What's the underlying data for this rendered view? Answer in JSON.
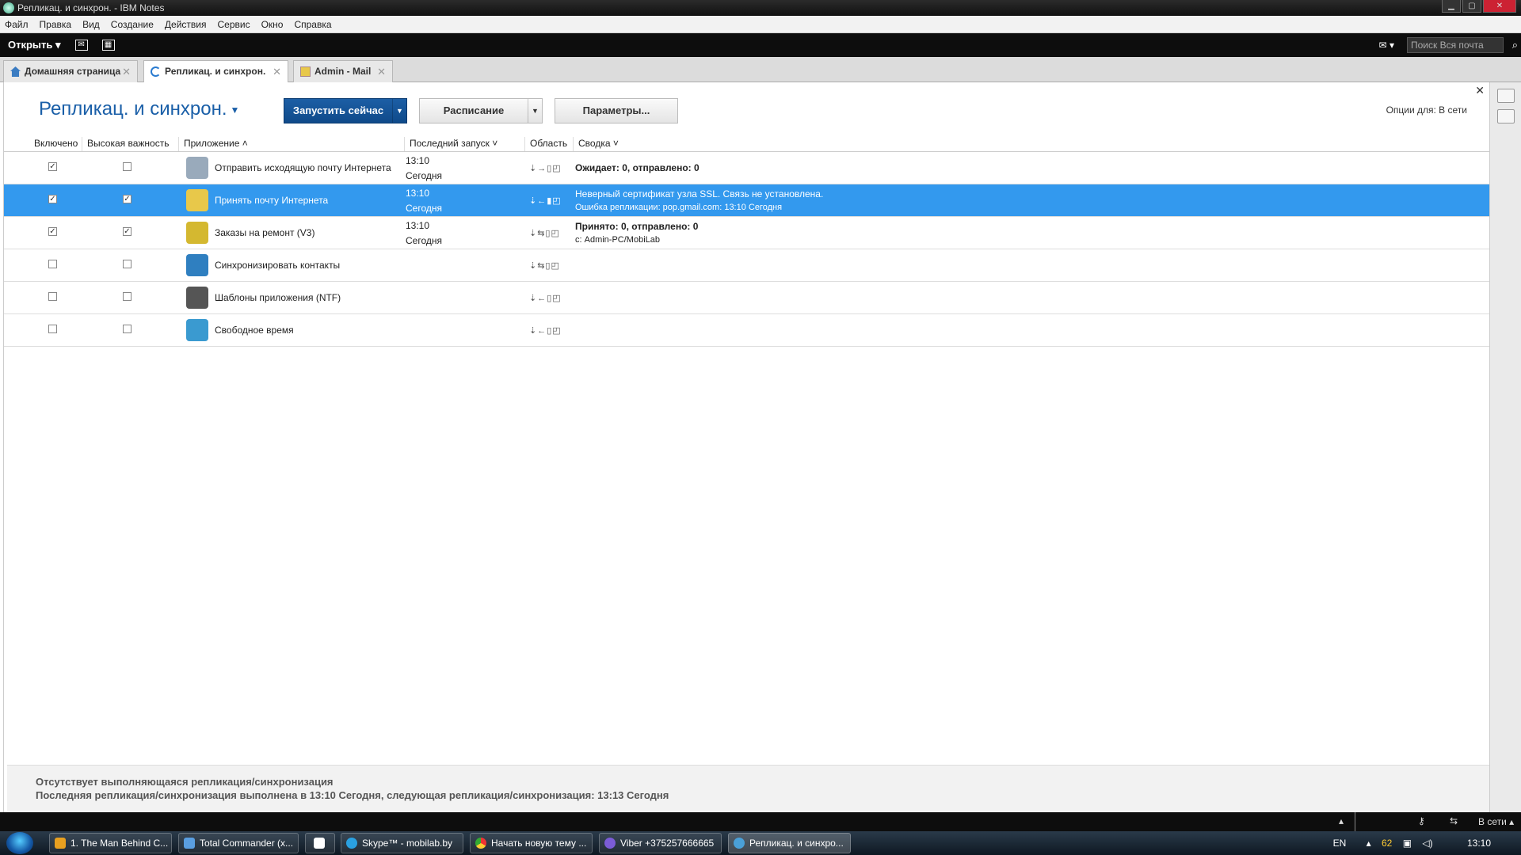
{
  "window": {
    "title": "Репликац. и синхрон. - IBM Notes"
  },
  "menu": [
    "Файл",
    "Правка",
    "Вид",
    "Создание",
    "Действия",
    "Сервис",
    "Окно",
    "Справка"
  ],
  "toolbar": {
    "open_label": "Открыть",
    "search_placeholder": "Поиск Вся почта"
  },
  "tabs": [
    {
      "label": "Домашняя страница"
    },
    {
      "label": "Репликац. и синхрон."
    },
    {
      "label": "Admin - Mail"
    }
  ],
  "page": {
    "title": "Репликац. и синхрон.",
    "run_now": "Запустить сейчас",
    "schedule": "Расписание",
    "params": "Параметры...",
    "options_for": "Опции для: В сети"
  },
  "columns": [
    "Включено",
    "Высокая важность",
    "Приложение",
    "Последний запуск",
    "Область",
    "Сводка"
  ],
  "rows": [
    {
      "enabled": true,
      "high": false,
      "app": "Отправить исходящую почту Интернета",
      "time": "13:10",
      "day": "Сегодня",
      "area": "⇣→▯◰",
      "summary1": "Ожидает: 0, отправлено: 0",
      "summary2": "",
      "icon_color": "#9ab"
    },
    {
      "enabled": true,
      "high": true,
      "app": "Принять почту Интернета",
      "time": "13:10",
      "day": "Сегодня",
      "area": "⇣←▮◰",
      "summary1": "Неверный сертификат узла SSL. Связь не установлена.",
      "summary2": "Ошибка репликации: pop.gmail.com: 13:10 Сегодня",
      "icon_color": "#e8c84a"
    },
    {
      "enabled": true,
      "high": true,
      "app": "Заказы на ремонт (V3)",
      "time": "13:10",
      "day": "Сегодня",
      "area": "⇣⇆▯◰",
      "summary1": "Принято: 0, отправлено: 0",
      "summary2": "с: Admin-PC/MobiLab",
      "icon_color": "#d4b830"
    },
    {
      "enabled": false,
      "high": false,
      "app": "Синхронизировать контакты",
      "time": "",
      "day": "",
      "area": "⇣⇆▯◰",
      "summary1": "",
      "summary2": "",
      "icon_color": "#2f7fc0"
    },
    {
      "enabled": false,
      "high": false,
      "app": "Шаблоны приложения (NTF)",
      "time": "",
      "day": "",
      "area": "⇣←▯◰",
      "summary1": "",
      "summary2": "",
      "icon_color": "#555"
    },
    {
      "enabled": false,
      "high": false,
      "app": "Свободное время",
      "time": "",
      "day": "",
      "area": "⇣←▯◰",
      "summary1": "",
      "summary2": "",
      "icon_color": "#3a9ad0"
    }
  ],
  "status": {
    "line1": "Отсутствует выполняющаяся репликация/синхронизация",
    "line2": "Последняя репликация/синхронизация выполнена в 13:10 Сегодня, следующая репликация/синхронизация:  13:13 Сегодня"
  },
  "statusbar": {
    "online": "В сети"
  },
  "taskbar": {
    "items": [
      "1. The Man Behind C...",
      "Total Commander (x...",
      "",
      "Skype™ - mobilab.by",
      "Начать новую тему ...",
      "Viber +375257666665",
      "Репликац. и синхро..."
    ],
    "lang": "EN",
    "battery": "62",
    "clock": "13:10"
  }
}
